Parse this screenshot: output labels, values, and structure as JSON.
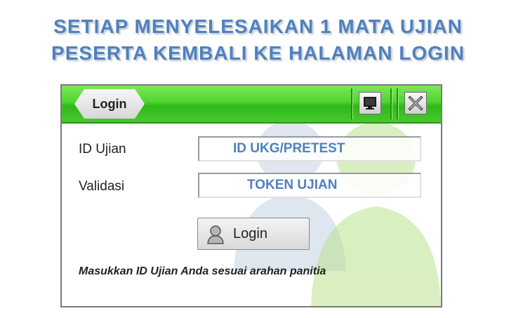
{
  "headline": {
    "line1": "SETIAP MENYELESAIKAN 1 MATA UJIAN",
    "line2": "PESERTA KEMBALI KE HALAMAN LOGIN"
  },
  "window": {
    "title": "Login",
    "icons": {
      "monitor": "monitor-icon",
      "close": "close-icon"
    }
  },
  "form": {
    "id_label": "ID Ujian",
    "id_value": "ID UKG/PRETEST",
    "validation_label": "Validasi",
    "validation_value": "TOKEN UJIAN",
    "login_button": "Login",
    "login_icon": "user-icon",
    "note": "Masukkan ID Ujian Anda sesuai arahan panitia"
  },
  "colors": {
    "headline": "#4f81bd",
    "titlebar": "#47c92c",
    "field_value": "#4f81bd"
  }
}
